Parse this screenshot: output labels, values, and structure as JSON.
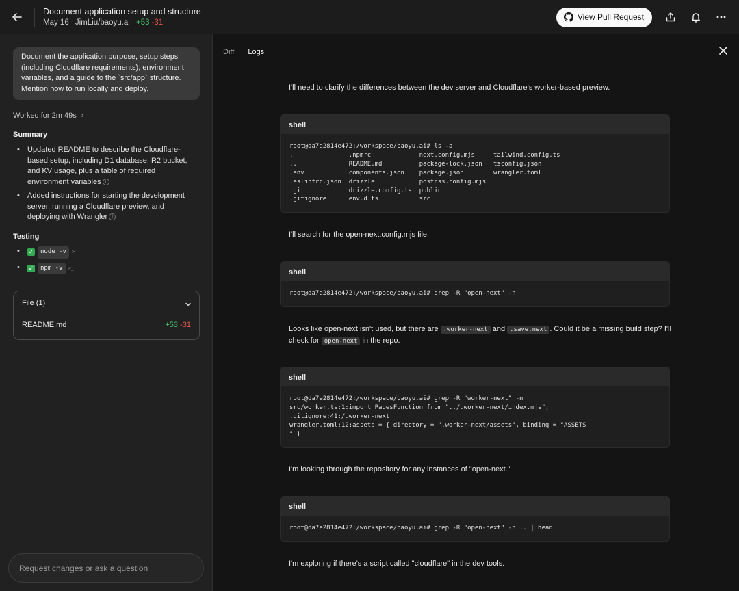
{
  "header": {
    "title": "Document application setup and structure",
    "date": "May 16",
    "repo": "JimLiu/baoyu.ai",
    "additions": "+53",
    "deletions": "-31",
    "pr_button": "View Pull Request"
  },
  "left": {
    "prompt": "Document the application purpose, setup steps (including Cloudflare requirements), environment variables, and a guide to the `src/app` structure. Mention how to run locally and deploy.",
    "worked": "Worked for 2m 49s",
    "summary_heading": "Summary",
    "summary": [
      "Updated README to describe the Cloudflare-based setup, including D1 database, R2 bucket, and KV usage, plus a table of required environment variables",
      "Added instructions for starting the development server, running a Cloudflare preview, and deploying with Wrangler"
    ],
    "testing_heading": "Testing",
    "tests": [
      "node -v",
      "npm -v"
    ],
    "file_header": "File (1)",
    "file_name": "README.md",
    "file_additions": "+53",
    "file_deletions": "-31",
    "ask_placeholder": "Request changes or ask a question"
  },
  "right": {
    "tab_diff": "Diff",
    "tab_logs": "Logs",
    "msg1": "I'll need to clarify the differences between the dev server and Cloudflare's worker-based preview.",
    "shell1_label": "shell",
    "shell1_output": "root@da7e2814e472:/workspace/baoyu.ai# ls -a\n.               .npmrc             next.config.mjs     tailwind.config.ts\n..              README.md          package-lock.json   tsconfig.json\n.env            components.json    package.json        wrangler.toml\n.eslintrc.json  drizzle            postcss.config.mjs\n.git            drizzle.config.ts  public\n.gitignore      env.d.ts           src",
    "msg2": "I'll search for the open-next.config.mjs file.",
    "shell2_label": "shell",
    "shell2_output": "root@da7e2814e472:/workspace/baoyu.ai# grep -R \"open-next\" -n",
    "msg3_a": "Looks like open-next isn't used, but there are ",
    "msg3_code1": ".worker-next",
    "msg3_b": " and ",
    "msg3_code2": ".save.next",
    "msg3_c": ". Could it be a missing build step? I'll check for ",
    "msg3_code3": "open-next",
    "msg3_d": " in the repo.",
    "shell3_label": "shell",
    "shell3_output": "root@da7e2814e472:/workspace/baoyu.ai# grep -R \"worker-next\" -n\nsrc/worker.ts:1:import PagesFunction from \"../.worker-next/index.mjs\";\n.gitignore:41:/.worker-next\nwrangler.toml:12:assets = { directory = \".worker-next/assets\", binding = \"ASSETS\n\" }",
    "msg4": "I'm looking through the repository for any instances of \"open-next.\"",
    "shell4_label": "shell",
    "shell4_output": "root@da7e2814e472:/workspace/baoyu.ai# grep -R \"open-next\" -n .. | head",
    "msg5": "I'm exploring if there's a script called \"cloudflare\" in the dev tools."
  }
}
